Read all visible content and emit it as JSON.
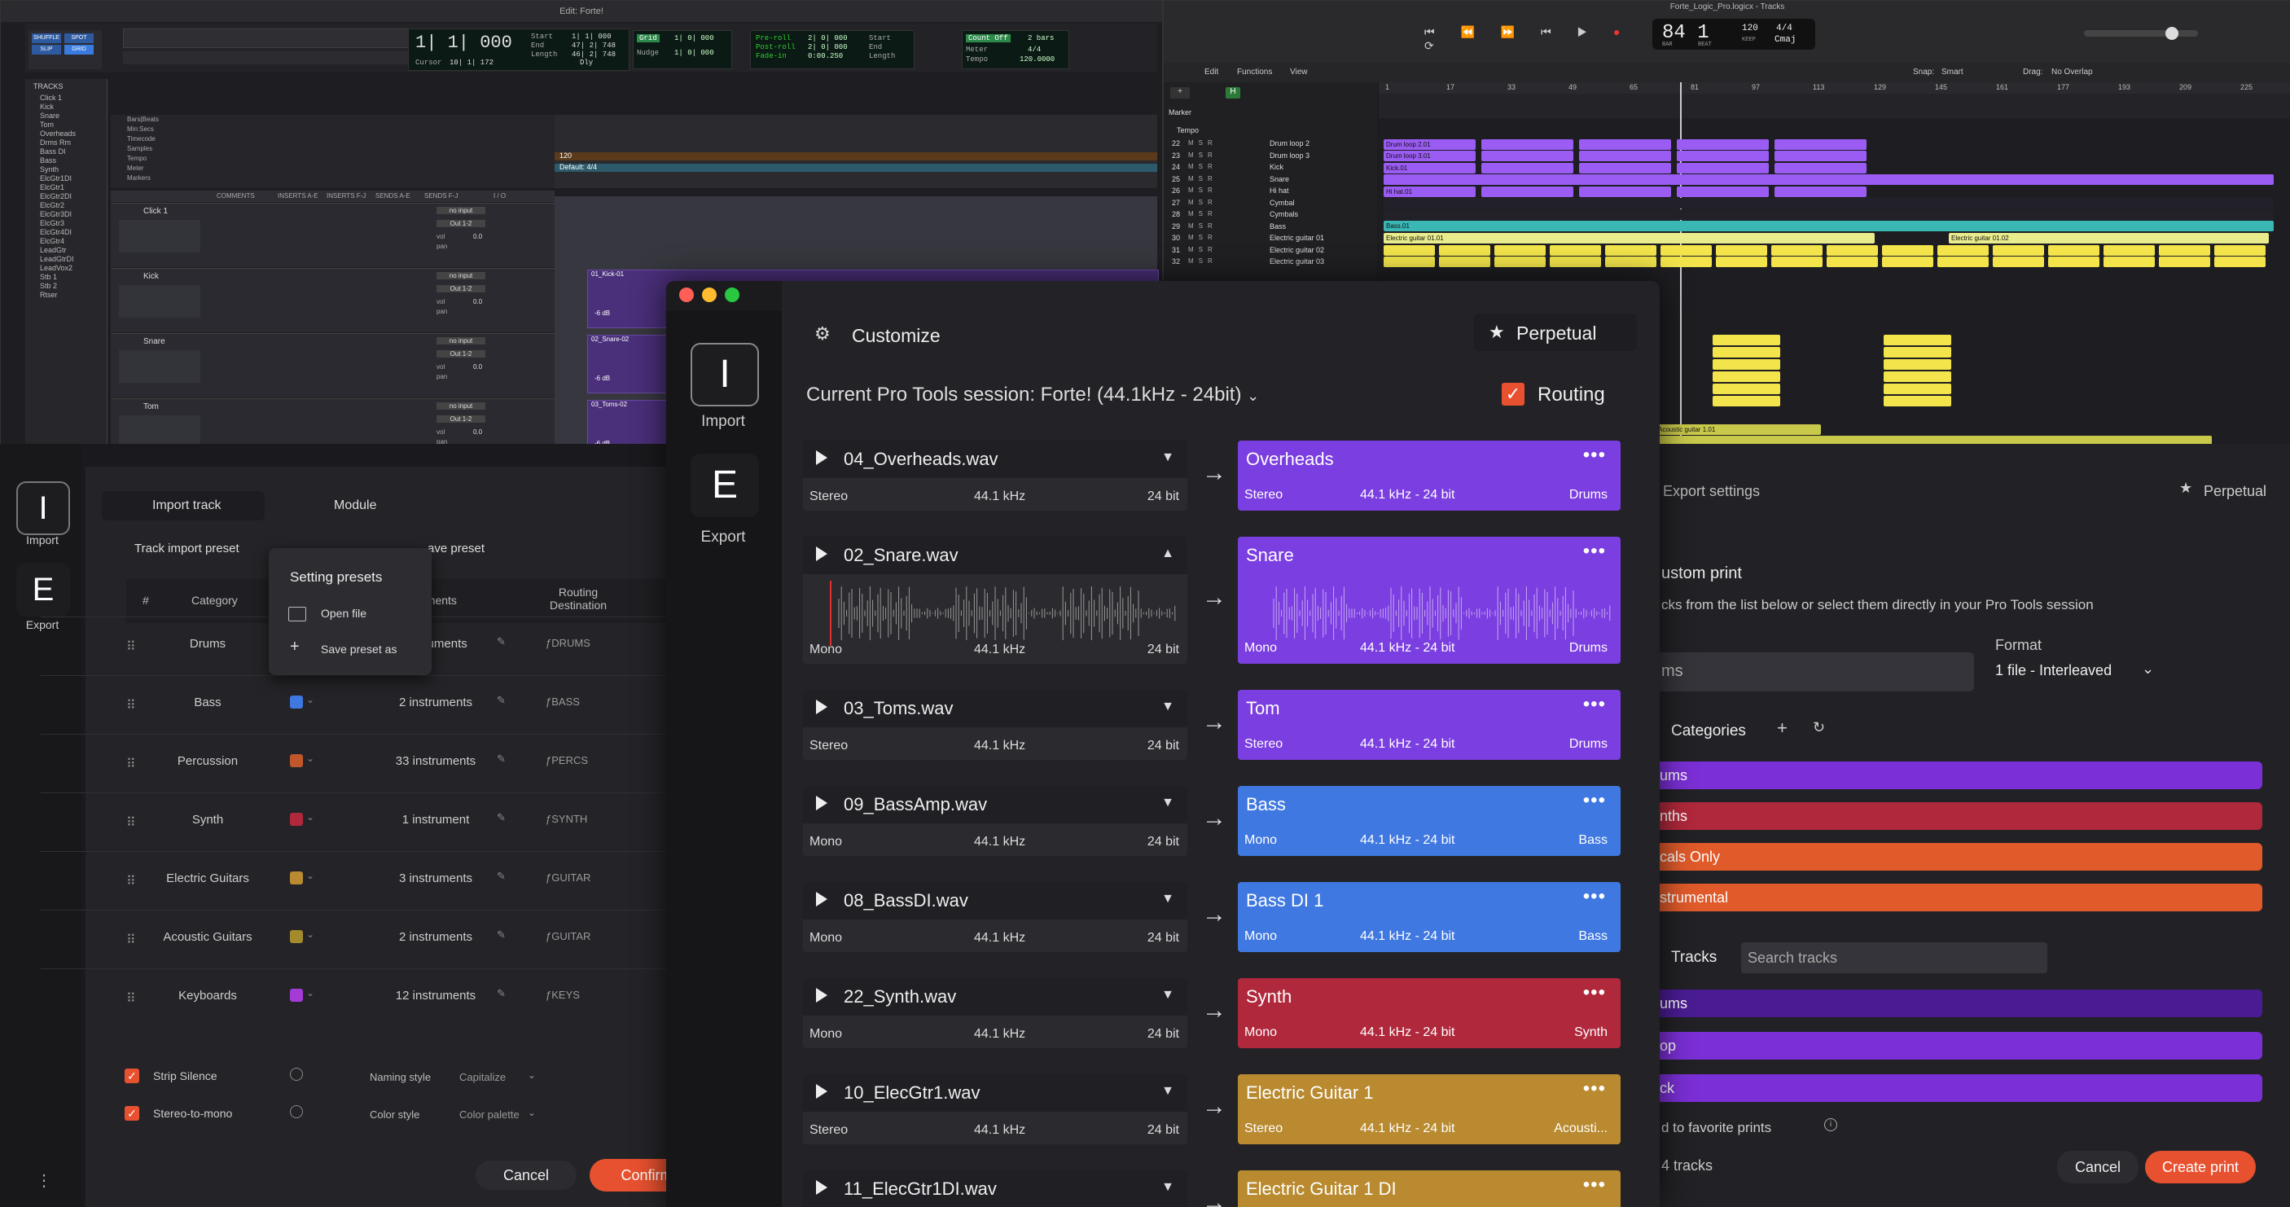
{
  "protools": {
    "title": "Edit: Forte!",
    "counter_main": "1| 1| 000",
    "counter_labels": [
      "Start",
      "End",
      "Length"
    ],
    "counter_values": [
      "1| 1| 000",
      "47| 2| 748",
      "46| 2| 748"
    ],
    "cursor_label": "Cursor",
    "cursor_value": "10| 1| 172",
    "dly_label": "Dly",
    "grid_label": "Grid",
    "nudge_label": "Nudge",
    "grid_value": "1| 0| 000",
    "nudge_value": "1| 0| 000",
    "preroll": [
      "Pre-roll",
      "Post-roll",
      "Fade-in"
    ],
    "preroll_values": [
      "2| 0| 000",
      "2| 0| 000",
      "0:00.250"
    ],
    "count_off": "Count Off",
    "meter_label": "Meter",
    "tempo_label": "Tempo",
    "bars": "2 bars",
    "meter": "4/4",
    "tempo": "120.0000",
    "tracks_header": "TRACKS",
    "track_names": [
      "Click 1",
      "Kick",
      "Snare",
      "Tom",
      "Overheads",
      "Drms Rm",
      "Bass DI",
      "Bass",
      "Synth",
      "ElcGtr1DI",
      "ElcGtr1",
      "ElcGtr2DI",
      "ElcGtr2",
      "ElcGtr3DI",
      "ElcGtr3",
      "ElcGtr4DI",
      "ElcGtr4",
      "LeadGtr",
      "LeadGtrDI",
      "LeadVox2",
      "Stb 1",
      "Stb 2",
      "Rtser"
    ],
    "rulers": [
      "Bars|Beats",
      "Min:Secs",
      "Timecode",
      "Samples",
      "Tempo",
      "Meter",
      "Markers"
    ],
    "mix_cols": [
      "COMMENTS",
      "INSERTS A-E",
      "INSERTS F-J",
      "SENDS A-E",
      "SENDS F-J",
      "I / O"
    ],
    "tracks": [
      {
        "name": "Click 1",
        "clip": ""
      },
      {
        "name": "Kick",
        "clip": "01_Kick-01"
      },
      {
        "name": "Snare",
        "clip": "02_Snare-02"
      },
      {
        "name": "Tom",
        "clip": "03_Toms-02"
      }
    ],
    "io_in": "no input",
    "io_out": "Out 1-2",
    "vol": "vol",
    "pan": "pan",
    "vol_val": "0.0",
    "tempo_marker": "120",
    "default_meter": "Default: 4/4",
    "db_label": "-6 dB"
  },
  "logic": {
    "title": "Forte_Logic_Pro.logicx - Tracks",
    "position": "84 1",
    "bar_label": "BAR",
    "beat_label": "BEAT",
    "tempo": "120",
    "tempo_label": "KEEP",
    "signature": "4/4",
    "key": "Cmaj",
    "edit_menu": "Edit",
    "functions_menu": "Functions",
    "view_menu": "View",
    "snap_label": "Snap:",
    "snap_value": "Smart",
    "drag_label": "Drag:",
    "drag_value": "No Overlap",
    "marker_label": "Marker",
    "tempo_row_label": "Tempo",
    "ruler_numbers": [
      "1",
      "17",
      "33",
      "49",
      "65",
      "81",
      "97",
      "113",
      "129",
      "145",
      "161",
      "177",
      "193",
      "209",
      "225"
    ],
    "tracks": [
      {
        "n": "22",
        "name": "Drum loop 2"
      },
      {
        "n": "23",
        "name": "Drum loop 3"
      },
      {
        "n": "24",
        "name": "Kick"
      },
      {
        "n": "25",
        "name": "Snare"
      },
      {
        "n": "26",
        "name": "Hi hat"
      },
      {
        "n": "27",
        "name": "Cymbal"
      },
      {
        "n": "28",
        "name": "Cymbals"
      },
      {
        "n": "29",
        "name": "Bass"
      },
      {
        "n": "30",
        "name": "Electric guitar 01"
      },
      {
        "n": "31",
        "name": "Electric guitar 02"
      },
      {
        "n": "32",
        "name": "Electric guitar 03"
      }
    ],
    "regions": {
      "drum_loop_2": "Drum loop 2.01",
      "drum_loop_3": "Drum loop 3.01",
      "kick": "Kick.01",
      "snare_hh": "Hi hat.01",
      "bass": "Bass.01",
      "eg1": "Electric guitar 01.01",
      "eg2": "Electric guitar 01.02",
      "ac": "Acoustic guitar 1.01"
    }
  },
  "import_panel": {
    "nav_import_letter": "I",
    "nav_import": "Import",
    "nav_export_letter": "E",
    "nav_export": "Export",
    "tab_import_track": "Import track",
    "tab_module": "Module",
    "track_import_preset": "Track import preset",
    "save_preset": "ave preset",
    "col_num": "#",
    "col_category": "Category",
    "col_instruments": "uments",
    "col_routing": "Routing\nDestination",
    "rows": [
      {
        "category": "Drums",
        "color": "",
        "instruments": "instruments",
        "dest": "ƒDRUMS"
      },
      {
        "category": "Bass",
        "color": "#3f78e0",
        "instruments": "2 instruments",
        "dest": "ƒBASS"
      },
      {
        "category": "Percussion",
        "color": "#c0572b",
        "instruments": "33 instruments",
        "dest": "ƒPERCS"
      },
      {
        "category": "Synth",
        "color": "#b0283c",
        "instruments": "1 instrument",
        "dest": "ƒSYNTH"
      },
      {
        "category": "Electric Guitars",
        "color": "#b98a2f",
        "instruments": "3 instruments",
        "dest": "ƒGUITAR"
      },
      {
        "category": "Acoustic Guitars",
        "color": "#a38a2d",
        "instruments": "2 instruments",
        "dest": "ƒGUITAR"
      },
      {
        "category": "Keyboards",
        "color": "#a43bd6",
        "instruments": "12 instruments",
        "dest": "ƒKEYS"
      }
    ],
    "popup_title": "Setting presets",
    "popup_open": "Open file",
    "popup_save": "Save preset as",
    "strip_silence": "Strip Silence",
    "stereo_to_mono": "Stereo-to-mono",
    "naming_style_label": "Naming style",
    "naming_style_value": "Capitalize",
    "color_style_label": "Color style",
    "color_style_value": "Color palette",
    "cancel": "Cancel",
    "confirm": "Confirm"
  },
  "export_panel": {
    "title": "Export settings",
    "perpetual": "Perpetual",
    "custom_print": "ustom print",
    "instructions": "cks from the list below or select them directly in your Pro Tools session",
    "format_label": "Format",
    "format_value": "1 file - Interleaved",
    "name_field": "ms",
    "categories_label": "Categories",
    "categories": [
      {
        "label": "ums",
        "color": "#7b2fd6"
      },
      {
        "label": "nths",
        "color": "#b0283c"
      },
      {
        "label": "cals Only",
        "color": "#e05a2a"
      },
      {
        "label": "strumental",
        "color": "#e05a2a"
      }
    ],
    "tracks_label": "Tracks",
    "search_placeholder": "Search tracks",
    "track_bars": [
      {
        "label": "ums",
        "color": "#4a1c93"
      },
      {
        "label": "op",
        "color": "#7b2fd6"
      },
      {
        "label": "ck",
        "color": "#7b2fd6"
      }
    ],
    "favorite": "d to favorite prints",
    "count": "4 tracks",
    "cancel": "Cancel",
    "create": "Create print"
  },
  "customize": {
    "nav_import_letter": "I",
    "nav_import": "Import",
    "nav_export_letter": "E",
    "nav_export": "Export",
    "title": "Customize",
    "license": "Perpetual",
    "session_label": "Current Pro Tools session: Forte! (44.1kHz - 24bit)",
    "routing_label": "Routing",
    "routing_checked": true,
    "rows": [
      {
        "file": "04_Overheads.wav",
        "chan": "Stereo",
        "rate": "44.1 kHz",
        "bits": "24 bit",
        "dest": "Overheads",
        "dest_chan": "Stereo",
        "dest_fmt": "44.1 kHz - 24 bit",
        "dest_cat": "Drums",
        "color": "#7b3ee0",
        "expanded": false
      },
      {
        "file": "02_Snare.wav",
        "chan": "Mono",
        "rate": "44.1 kHz",
        "bits": "24 bit",
        "dest": "Snare",
        "dest_chan": "Mono",
        "dest_fmt": "44.1 kHz - 24 bit",
        "dest_cat": "Drums",
        "color": "#7b3ee0",
        "expanded": true
      },
      {
        "file": "03_Toms.wav",
        "chan": "Stereo",
        "rate": "44.1 kHz",
        "bits": "24 bit",
        "dest": "Tom",
        "dest_chan": "Stereo",
        "dest_fmt": "44.1 kHz - 24 bit",
        "dest_cat": "Drums",
        "color": "#7b3ee0",
        "expanded": false
      },
      {
        "file": "09_BassAmp.wav",
        "chan": "Mono",
        "rate": "44.1 kHz",
        "bits": "24 bit",
        "dest": "Bass",
        "dest_chan": "Mono",
        "dest_fmt": "44.1 kHz - 24 bit",
        "dest_cat": "Bass",
        "color": "#3f78e0",
        "expanded": false
      },
      {
        "file": "08_BassDI.wav",
        "chan": "Mono",
        "rate": "44.1 kHz",
        "bits": "24 bit",
        "dest": "Bass DI 1",
        "dest_chan": "Mono",
        "dest_fmt": "44.1 kHz - 24 bit",
        "dest_cat": "Bass",
        "color": "#3f78e0",
        "expanded": false
      },
      {
        "file": "22_Synth.wav",
        "chan": "Mono",
        "rate": "44.1 kHz",
        "bits": "24 bit",
        "dest": "Synth",
        "dest_chan": "Mono",
        "dest_fmt": "44.1 kHz - 24 bit",
        "dest_cat": "Synth",
        "color": "#b0283c",
        "expanded": false
      },
      {
        "file": "10_ElecGtr1.wav",
        "chan": "Stereo",
        "rate": "44.1 kHz",
        "bits": "24 bit",
        "dest": "Electric Guitar 1",
        "dest_chan": "Stereo",
        "dest_fmt": "44.1 kHz - 24 bit",
        "dest_cat": "Acousti...",
        "color": "#b98a2f",
        "expanded": false
      },
      {
        "file": "11_ElecGtr1DI.wav",
        "chan": "",
        "rate": "",
        "bits": "",
        "dest": "Electric Guitar 1 DI",
        "dest_chan": "",
        "dest_fmt": "",
        "dest_cat": "",
        "color": "#b98a2f",
        "expanded": false
      }
    ]
  }
}
